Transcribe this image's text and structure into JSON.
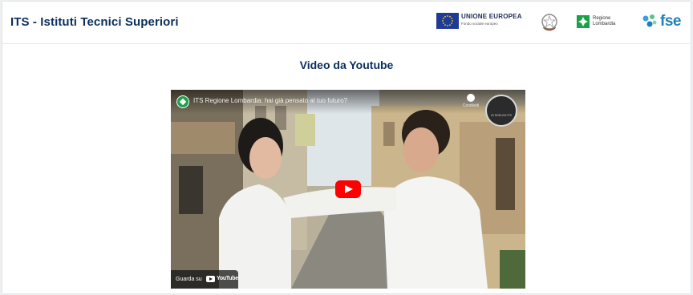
{
  "header": {
    "site_title": "ITS - Istituti Tecnici Superiori",
    "logos": {
      "eu_title": "UNIONE EUROPEA",
      "eu_subtitle": "Fondo sociale europeo",
      "region_name": "Regione\nLombardia",
      "fse": "fse"
    }
  },
  "section": {
    "title": "Video da Youtube"
  },
  "video": {
    "title": "ITS Regione Lombardia: hai già pensato al tuo futuro?",
    "share_label": "Condividi",
    "badge_text": "Io scelgo ITS",
    "watch_on_label": "Guarda su",
    "youtube_wordmark": "YouTube"
  },
  "colors": {
    "title_blue": "#0b2e5c",
    "eu_blue": "#1f3b99",
    "lombardia_green": "#1aa24a",
    "fse_blue": "#1f7fb8",
    "youtube_red": "#ff0000"
  }
}
